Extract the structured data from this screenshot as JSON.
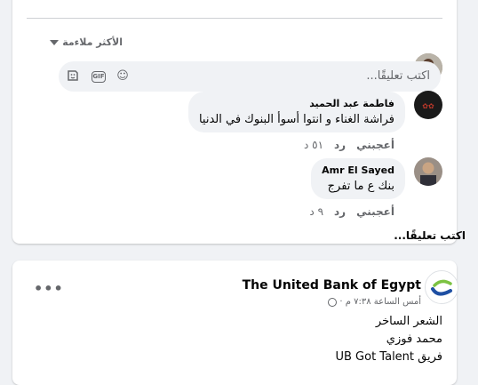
{
  "comments_section": {
    "filter_label": "الأكثر ملاءمة",
    "input_placeholder": "اكتب تعليقًا...",
    "comments": [
      {
        "author": "فاطمة عبد الحميد",
        "text": "فراشة الغناء و انتوا أسوأ البنوك في الدنيا",
        "like_label": "أعجبني",
        "reply_label": "رد",
        "time": "٥١ د"
      },
      {
        "author": "Amr El Sayed",
        "text": "بنك ع ما تفرج",
        "like_label": "أعجبني",
        "reply_label": "رد",
        "time": "٩ د"
      }
    ],
    "write_comment_link": "اكتب تعليقًا..."
  },
  "post": {
    "page_name": "The United Bank of Egypt",
    "timestamp": "أمس الساعة ٧:٣٨ م ·",
    "lines": [
      "الشعر الساخر",
      "محمد فوزي",
      "فريق UB Got Talent"
    ]
  },
  "icons": {
    "gif_label": "GIF"
  },
  "colors": {
    "background": "#f0f2f5",
    "card": "#ffffff",
    "bubble": "#f0f2f5",
    "secondary_text": "#65676b",
    "brand_blue": "#1e4fa3",
    "brand_green": "#7cc242"
  }
}
